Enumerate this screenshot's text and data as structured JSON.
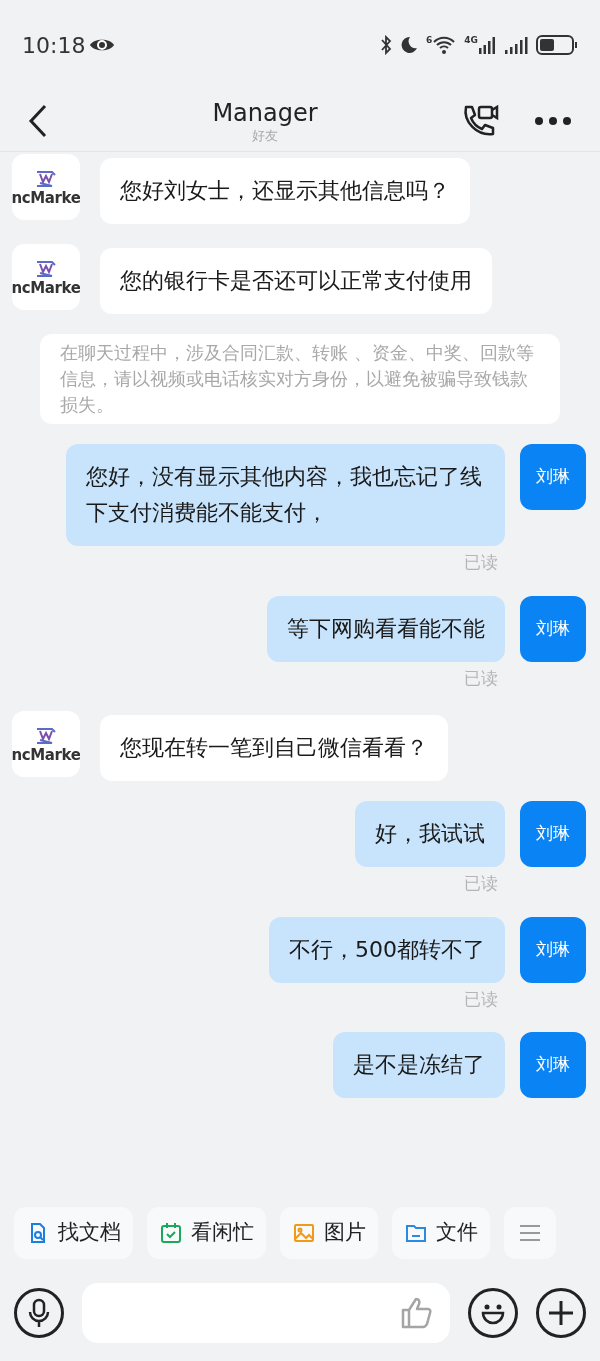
{
  "status_bar": {
    "time": "10:18",
    "wifi_label": "6",
    "network_label": "4G"
  },
  "header": {
    "title": "Manager",
    "subtitle": "好友"
  },
  "messages": [
    {
      "kind": "incoming",
      "avatar_text": "ncMarke",
      "text": "您好刘女士，还显示其他信息吗？"
    },
    {
      "kind": "incoming",
      "avatar_text": "ncMarke",
      "text": "您的银行卡是否还可以正常支付使用"
    },
    {
      "kind": "notice",
      "text": "在聊天过程中，涉及合同汇款、转账 、资金、中奖、回款等信息，请以视频或电话核实对方身份，以避免被骗导致钱款损失。"
    },
    {
      "kind": "outgoing",
      "avatar_text": "刘琳",
      "text": "您好，没有显示其他内容，我也忘记了线下支付消费能不能支付，",
      "receipt": "已读"
    },
    {
      "kind": "outgoing",
      "avatar_text": "刘琳",
      "text": "等下网购看看能不能",
      "receipt": "已读"
    },
    {
      "kind": "incoming",
      "avatar_text": "ncMarke",
      "text": "您现在转一笔到自己微信看看？"
    },
    {
      "kind": "outgoing",
      "avatar_text": "刘琳",
      "text": "好，我试试",
      "receipt": "已读"
    },
    {
      "kind": "outgoing",
      "avatar_text": "刘琳",
      "text": "不行，500都转不了",
      "receipt": "已读"
    },
    {
      "kind": "outgoing",
      "avatar_text": "刘琳",
      "text": "是不是冻结了"
    }
  ],
  "quick_actions": [
    {
      "kind": "doc",
      "label": "找文档"
    },
    {
      "kind": "calendar",
      "label": "看闲忙"
    },
    {
      "kind": "image",
      "label": "图片"
    },
    {
      "kind": "folder",
      "label": "文件"
    },
    {
      "kind": "more"
    }
  ]
}
